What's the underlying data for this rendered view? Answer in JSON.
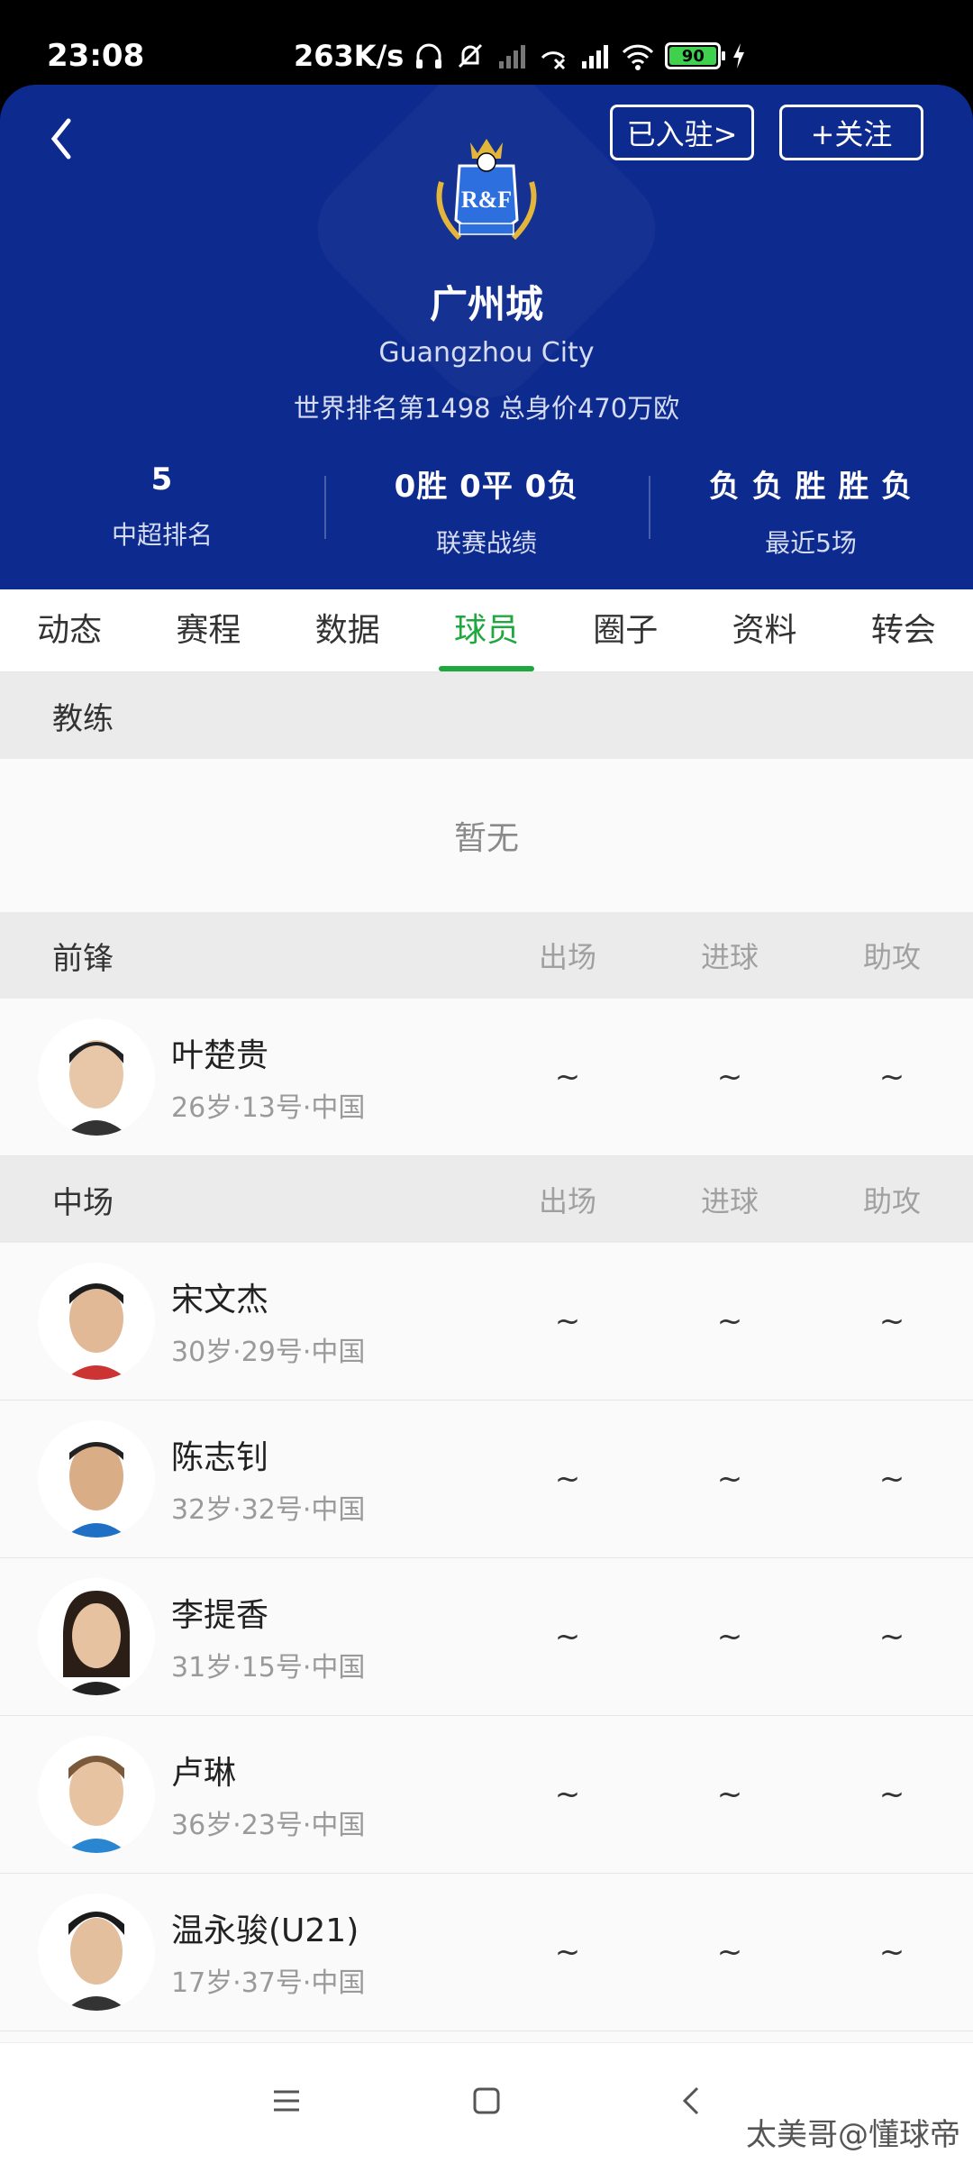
{
  "status_bar": {
    "time": "23:08",
    "network_speed": "263K/s",
    "battery": "90"
  },
  "header": {
    "joined_label": "已入驻>",
    "follow_label": "+关注",
    "logo_text": "R&F",
    "team_name": "广州城",
    "team_name_en": "Guangzhou City",
    "meta": "世界排名第1498  总身价470万欧",
    "stats": [
      {
        "value": "5",
        "label": "中超排名"
      },
      {
        "value": "0胜 0平 0负",
        "label": "联赛战绩"
      },
      {
        "value": "负 负 胜 胜 负",
        "label": "最近5场"
      }
    ]
  },
  "tabs": [
    "动态",
    "赛程",
    "数据",
    "球员",
    "圈子",
    "资料",
    "转会"
  ],
  "active_tab": "球员",
  "sections": {
    "coach": {
      "title": "教练",
      "empty_text": "暂无"
    },
    "forward": {
      "title": "前锋",
      "cols": [
        "出场",
        "进球",
        "助攻"
      ],
      "players": [
        {
          "name": "叶楚贵",
          "meta": "26岁·13号·中国",
          "apps": "~",
          "goals": "~",
          "assists": "~"
        }
      ]
    },
    "midfield": {
      "title": "中场",
      "cols": [
        "出场",
        "进球",
        "助攻"
      ],
      "players": [
        {
          "name": "宋文杰",
          "meta": "30岁·29号·中国",
          "apps": "~",
          "goals": "~",
          "assists": "~"
        },
        {
          "name": "陈志钊",
          "meta": "32岁·32号·中国",
          "apps": "~",
          "goals": "~",
          "assists": "~"
        },
        {
          "name": "李提香",
          "meta": "31岁·15号·中国",
          "apps": "~",
          "goals": "~",
          "assists": "~"
        },
        {
          "name": "卢琳",
          "meta": "36岁·23号·中国",
          "apps": "~",
          "goals": "~",
          "assists": "~"
        },
        {
          "name": "温永骏(U21)",
          "meta": "17岁·37号·中国",
          "apps": "~",
          "goals": "~",
          "assists": "~"
        }
      ]
    }
  },
  "watermark": "太美哥@懂球帝",
  "colors": {
    "header_bg": "#0d2a8e",
    "accent": "#1fa83d"
  }
}
